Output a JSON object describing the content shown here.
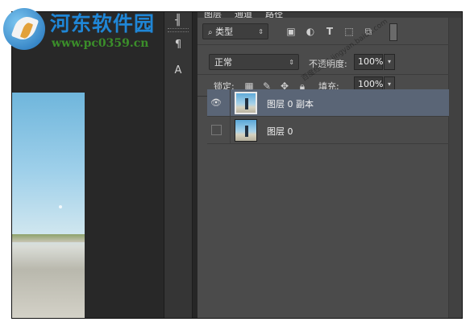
{
  "brand": {
    "name": "河东软件园",
    "url": "www.pc0359.cn"
  },
  "panel": {
    "tabs": [
      "图层",
      "通道",
      "路径"
    ],
    "filter": {
      "kind_label": "类型",
      "icons": [
        "image-filter-icon",
        "adjustment-filter-icon",
        "text-filter-icon",
        "shape-filter-icon",
        "smart-object-filter-icon",
        "filter-toggle-icon"
      ]
    },
    "blend_mode": "正常",
    "opacity_label": "不透明度:",
    "opacity_value": "100%",
    "lock_label": "锁定:",
    "lock_icons": [
      "lock-transparent-icon",
      "lock-image-icon",
      "lock-position-icon",
      "lock-all-icon"
    ],
    "fill_label": "填充:",
    "fill_value": "100%",
    "layers": [
      {
        "name": "图层 0 副本",
        "visible": true,
        "selected": true
      },
      {
        "name": "图层 0",
        "visible": false,
        "selected": false
      }
    ]
  },
  "tools": {
    "icons": [
      "paragraph-icon",
      "character-icon"
    ]
  },
  "overlay_text": "百度经验 | jingyan.baidu.com"
}
